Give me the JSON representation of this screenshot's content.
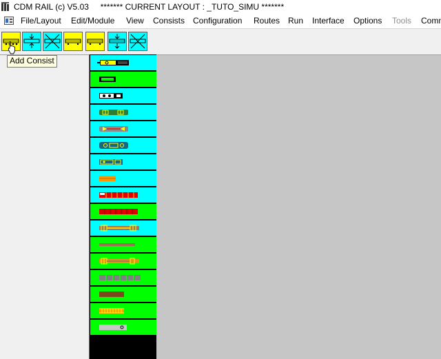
{
  "window": {
    "title": "CDM RAIL (c) V5.03     ******* CURRENT LAYOUT : _TUTO_SIMU *******"
  },
  "menu": {
    "items": [
      {
        "label": "File/Layout"
      },
      {
        "label": "Edit/Module"
      },
      {
        "label": "View"
      },
      {
        "label": "Consists"
      },
      {
        "label": "Configuration"
      },
      {
        "label": "Routes"
      },
      {
        "label": "Run"
      },
      {
        "label": "Interface"
      },
      {
        "label": "Options"
      },
      {
        "label": "Tools",
        "disabled": true
      },
      {
        "label": "Comm"
      }
    ]
  },
  "toolbar": {
    "buttons": [
      {
        "name": "add-consist",
        "bg": "#ffff00"
      },
      {
        "name": "consist-split",
        "bg": "#00ffff"
      },
      {
        "name": "consist-delete",
        "bg": "#00ffff"
      },
      {
        "name": "consist-yellow-1",
        "bg": "#ffff00"
      },
      {
        "name": "consist-yellow-2",
        "bg": "#ffff00"
      },
      {
        "name": "consist-merge",
        "bg": "#00ffff"
      },
      {
        "name": "consist-remove",
        "bg": "#00ffff"
      }
    ],
    "tooltip": "Add Consist"
  },
  "palette": {
    "rows": [
      {
        "bg": "#00ffff",
        "icon": "loco-yellow-black"
      },
      {
        "bg": "#00ff00",
        "icon": "loco-black-small"
      },
      {
        "bg": "#00ffff",
        "icon": "loco-black-wheels"
      },
      {
        "bg": "#00ffff",
        "icon": "car-green-yellow"
      },
      {
        "bg": "#00ffff",
        "icon": "car-gray-yellow"
      },
      {
        "bg": "#00ffff",
        "icon": "car-teal-round"
      },
      {
        "bg": "#00ffff",
        "icon": "car-teal-small"
      },
      {
        "bg": "#00ffff",
        "icon": "car-orange-short"
      },
      {
        "bg": "#00ffff",
        "icon": "car-red-segmented"
      },
      {
        "bg": "#00ff00",
        "icon": "car-red-long"
      },
      {
        "bg": "#00ffff",
        "icon": "car-brown-yellow"
      },
      {
        "bg": "#00ff00",
        "icon": "car-brown-flat"
      },
      {
        "bg": "#00ff00",
        "icon": "car-orange-yellow"
      },
      {
        "bg": "#00ff00",
        "icon": "car-gray-segmented"
      },
      {
        "bg": "#00ff00",
        "icon": "car-brown-box"
      },
      {
        "bg": "#00ff00",
        "icon": "car-orange-grill"
      },
      {
        "bg": "#00ff00",
        "icon": "car-gray-dot"
      }
    ]
  }
}
